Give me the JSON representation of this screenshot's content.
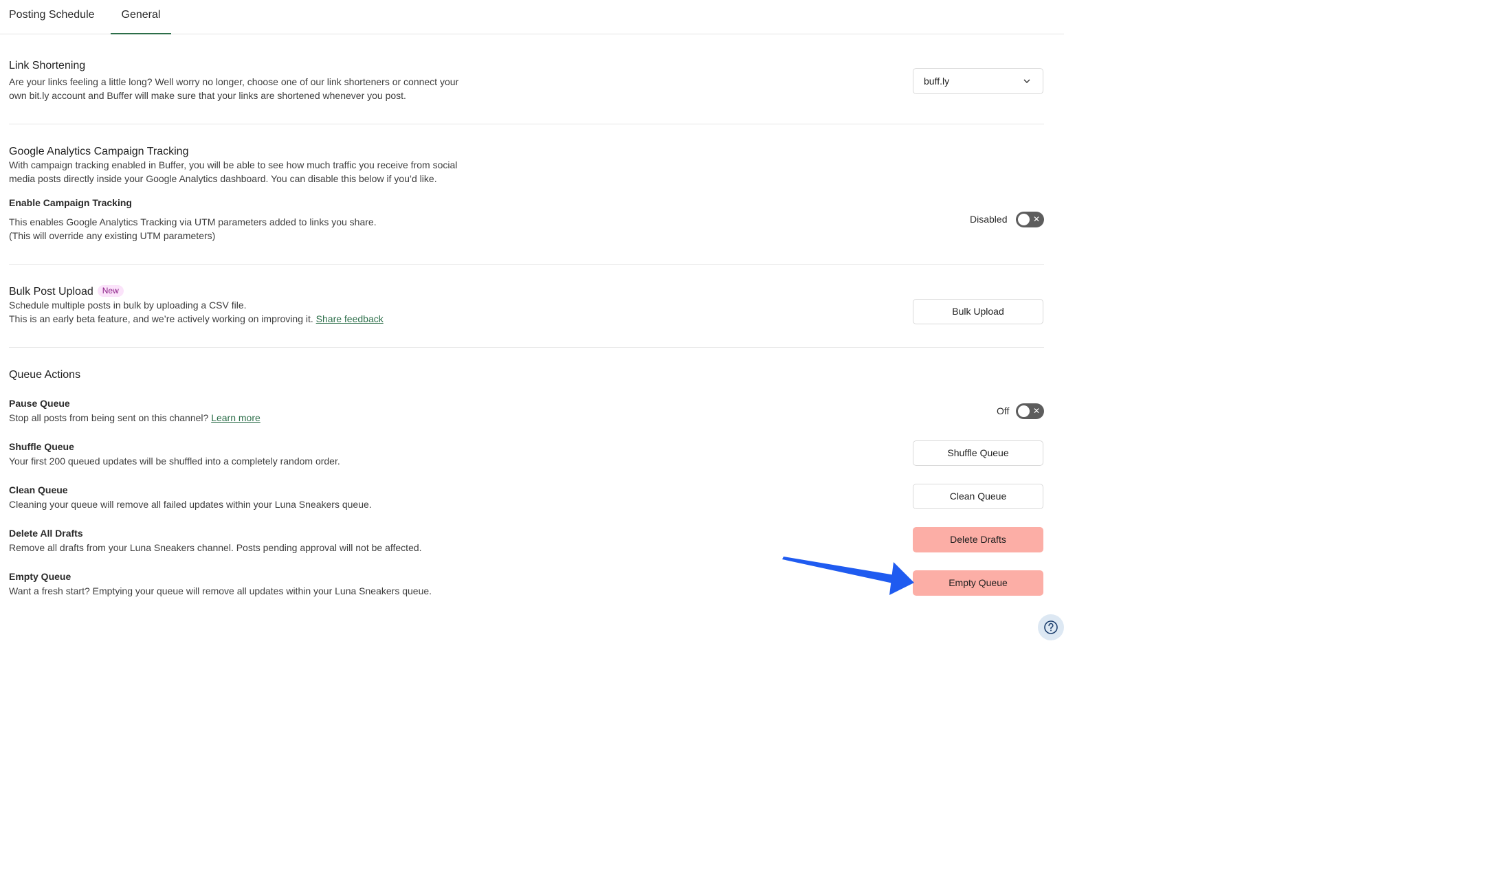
{
  "tabs": [
    {
      "label": "Posting Schedule"
    },
    {
      "label": "General"
    }
  ],
  "link_shortening": {
    "title": "Link Shortening",
    "desc_line1": "Are your links feeling a little long? Well worry no longer, choose one of our link shorteners or connect your",
    "desc_line2": "own bit.ly account and Buffer will make sure that your links are shortened whenever you post.",
    "select_value": "buff.ly"
  },
  "ga": {
    "title": "Google Analytics Campaign Tracking",
    "desc_line1": "With campaign tracking enabled in Buffer, you will be able to see how much traffic you receive from social",
    "desc_line2": "media posts directly inside your Google Analytics dashboard. You can disable this below if you’d like.",
    "enable_title": "Enable Campaign Tracking",
    "enable_desc_line1": "This enables Google Analytics Tracking via UTM parameters added to links you share.",
    "enable_desc_line2": "(This will override any existing UTM parameters)",
    "toggle_label": "Disabled"
  },
  "bulk": {
    "title": "Bulk Post Upload",
    "badge": "New",
    "desc_line1": "Schedule multiple posts in bulk by uploading a CSV file.",
    "desc_line2": "This is an early beta feature, and we’re actively working on improving it.",
    "feedback_link": "Share feedback",
    "button": "Bulk Upload"
  },
  "queue": {
    "title": "Queue Actions",
    "pause": {
      "title": "Pause Queue",
      "desc": "Stop all posts from being sent on this channel?",
      "link": "Learn more",
      "toggle_label": "Off"
    },
    "shuffle": {
      "title": "Shuffle Queue",
      "desc": "Your first 200 queued updates will be shuffled into a completely random order.",
      "button": "Shuffle Queue"
    },
    "clean": {
      "title": "Clean Queue",
      "desc": "Cleaning your queue will remove all failed updates within your Luna Sneakers queue.",
      "button": "Clean Queue"
    },
    "drafts": {
      "title": "Delete All Drafts",
      "desc": "Remove all drafts from your Luna Sneakers channel. Posts pending approval will not be affected.",
      "button": "Delete Drafts"
    },
    "empty": {
      "title": "Empty Queue",
      "desc": "Want a fresh start? Emptying your queue will remove all updates within your Luna Sneakers queue.",
      "button": "Empty Queue"
    }
  },
  "icons": {
    "help": "help-icon",
    "chevron": "chevron-down-icon",
    "annotation": "arrow-annotation"
  },
  "colors": {
    "accent": "#2c6e49",
    "danger_button": "#fcaea6",
    "toggle_off": "#5d5d5d",
    "arrow": "#1f5bf0"
  }
}
